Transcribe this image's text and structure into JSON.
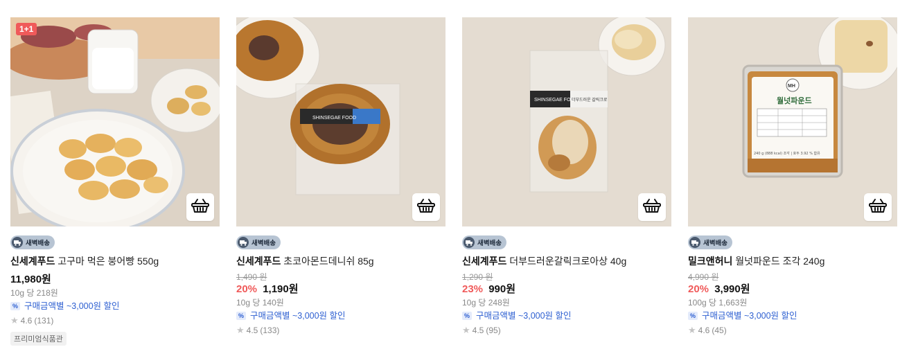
{
  "products": [
    {
      "badge": "1+1",
      "delivery": "새벽배송",
      "brand": "신세계푸드",
      "name": "고구마 먹은 붕어빵 550g",
      "original_price": "",
      "discount_rate": "",
      "price": "11,980원",
      "unit_price": "10g 당 218원",
      "coupon": "구매금액별 ~3,000원 할인",
      "rating": "4.6",
      "reviews": "(131)",
      "store": "프리미엄식품관"
    },
    {
      "badge": "",
      "delivery": "새벽배송",
      "brand": "신세계푸드",
      "name": "초코아몬드데니쉬 85g",
      "original_price": "1,490 원",
      "discount_rate": "20%",
      "price": "1,190원",
      "unit_price": "10g 당 140원",
      "coupon": "구매금액별 ~3,000원 할인",
      "rating": "4.5",
      "reviews": "(133)",
      "store": ""
    },
    {
      "badge": "",
      "delivery": "새벽배송",
      "brand": "신세계푸드",
      "name": "더부드러운갈릭크로아상 40g",
      "original_price": "1,290 원",
      "discount_rate": "23%",
      "price": "990원",
      "unit_price": "10g 당 248원",
      "coupon": "구매금액별 ~3,000원 할인",
      "rating": "4.5",
      "reviews": "(95)",
      "store": ""
    },
    {
      "badge": "",
      "delivery": "새벽배송",
      "brand": "밀크앤허니",
      "name": "월넛파운드 조각 240g",
      "original_price": "4,990 원",
      "discount_rate": "20%",
      "price": "3,990원",
      "unit_price": "100g 당 1,663원",
      "coupon": "구매금액별 ~3,000원 할인",
      "rating": "4.6",
      "reviews": "(45)",
      "store": ""
    }
  ],
  "package_labels": {
    "p2": "SHINSEGAE FOOD",
    "p3a": "SHINSEGAE FOOD",
    "p3b": "더부드러운 갈릭크로",
    "p4_logo": "MH",
    "p4_name": "월넛파운드",
    "p4_footer": "240 g (888 kcal) 조각 | 호두 3.92 % 함유"
  },
  "icons": {
    "cart": "basket-icon",
    "delivery": "truck-icon",
    "coupon": "coupon-icon",
    "rating": "star-icon"
  },
  "colors": {
    "discount": "#f05a5a",
    "coupon": "#2d5fd1",
    "badge": "#f05a5a",
    "delivery_tag": "#b7c4d3"
  }
}
